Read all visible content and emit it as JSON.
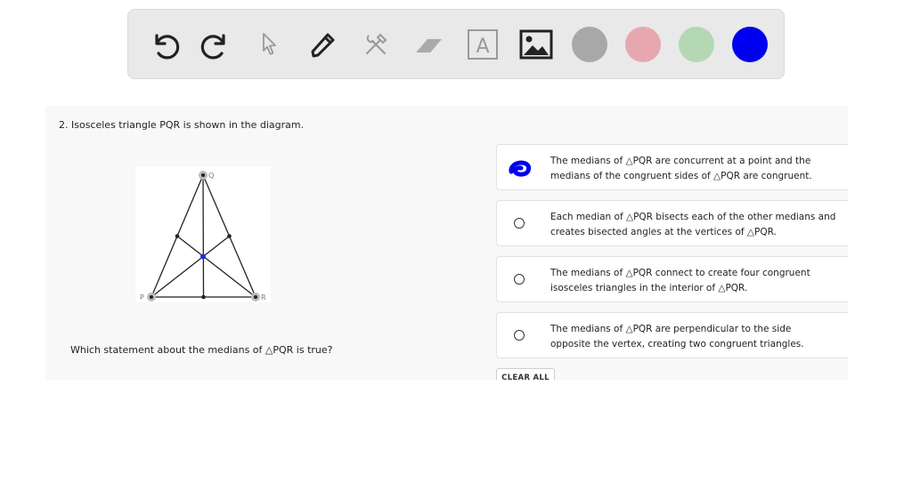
{
  "toolbar": {
    "tools": [
      {
        "name": "undo",
        "icon": "undo-icon"
      },
      {
        "name": "redo",
        "icon": "redo-icon"
      },
      {
        "name": "select",
        "icon": "pointer-icon"
      },
      {
        "name": "pen",
        "icon": "pen-icon"
      },
      {
        "name": "tools",
        "icon": "wrench-hammer-icon"
      },
      {
        "name": "eraser",
        "icon": "eraser-icon"
      },
      {
        "name": "text",
        "icon": "text-box-icon",
        "glyph": "A"
      },
      {
        "name": "image",
        "icon": "image-icon"
      }
    ],
    "colors": [
      "#a8a8a8",
      "#e6a8ae",
      "#b4d8b4",
      "#0000f0"
    ],
    "selected_color": "#0000f0"
  },
  "question": {
    "title": "2. Isosceles triangle PQR is shown in the diagram.",
    "prompt": "Which statement about the medians of △PQR is true?",
    "figure": {
      "labels": {
        "P": "P",
        "Q": "Q",
        "R": "R"
      },
      "centroid_color": "#1a2fe0"
    },
    "choices": [
      {
        "lines": [
          "The medians of △PQR are concurrent at a point and the",
          "medians of the congruent sides of △PQR are congruent."
        ],
        "selected": true
      },
      {
        "lines": [
          "Each median of △PQR bisects each of the other medians and",
          "creates bisected angles at the vertices of △PQR."
        ],
        "selected": false
      },
      {
        "lines": [
          "The medians of △PQR connect to create four congruent",
          "isosceles triangles in the interior of △PQR."
        ],
        "selected": false
      },
      {
        "lines": [
          "The medians of △PQR are perpendicular to the side",
          "opposite the vertex, creating two congruent triangles."
        ],
        "selected": false
      }
    ],
    "clear_label": "CLEAR ALL"
  }
}
